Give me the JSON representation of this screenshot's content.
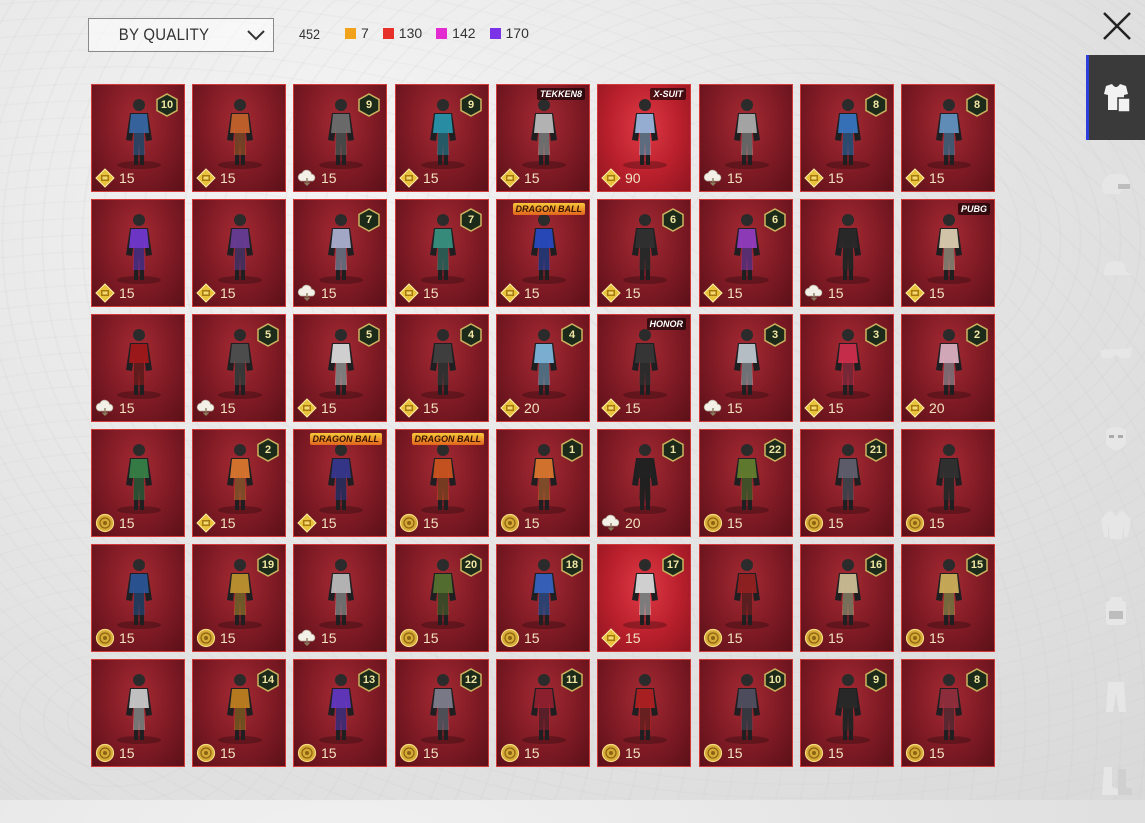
{
  "header": {
    "sort_label": "BY QUALITY",
    "total_count": "452",
    "rarity_counts": [
      {
        "color": "#f2a11b",
        "count": "7"
      },
      {
        "color": "#e8302a",
        "count": "130"
      },
      {
        "color": "#e22bd0",
        "count": "142"
      },
      {
        "color": "#7b32e6",
        "count": "170"
      }
    ]
  },
  "sidebar": {
    "tabs": [
      {
        "icon": "outfit-icon",
        "active": true
      },
      {
        "icon": "helmet-icon",
        "active": false
      },
      {
        "icon": "cap-icon",
        "active": false
      },
      {
        "icon": "goggles-icon",
        "active": false
      },
      {
        "icon": "mask-icon",
        "active": false
      },
      {
        "icon": "jacket-icon",
        "active": false
      },
      {
        "icon": "backpack-icon",
        "active": false
      },
      {
        "icon": "pants-icon",
        "active": false
      },
      {
        "icon": "boots-icon",
        "active": false
      }
    ]
  },
  "grid": {
    "cards": [
      {
        "level": "10",
        "currency": "coin",
        "cost": "15",
        "accent": "#3a6fb0"
      },
      {
        "level": "",
        "currency": "coin",
        "cost": "15",
        "accent": "#d86a2a"
      },
      {
        "level": "9",
        "currency": "cloud",
        "cost": "15",
        "accent": "#777"
      },
      {
        "level": "9",
        "currency": "coin",
        "cost": "15",
        "accent": "#2aa0b8"
      },
      {
        "level": "",
        "currency": "coin",
        "cost": "15",
        "accent": "#ccc",
        "logo": "TEKKEN8"
      },
      {
        "level": "",
        "currency": "coin",
        "cost": "90",
        "accent": "#a9c7f0",
        "logo": "X-SUIT",
        "bright": true
      },
      {
        "level": "",
        "currency": "cloud",
        "cost": "15",
        "accent": "#bbb"
      },
      {
        "level": "8",
        "currency": "coin",
        "cost": "15",
        "accent": "#3a7fd0"
      },
      {
        "level": "8",
        "currency": "coin",
        "cost": "15",
        "accent": "#6aa0d0"
      },
      {
        "level": "",
        "currency": "coin",
        "cost": "15",
        "accent": "#7a3ae0"
      },
      {
        "level": "",
        "currency": "coin",
        "cost": "15",
        "accent": "#7040a0"
      },
      {
        "level": "7",
        "currency": "cloud",
        "cost": "15",
        "accent": "#b8bfe0"
      },
      {
        "level": "7",
        "currency": "coin",
        "cost": "15",
        "accent": "#3a9e8a"
      },
      {
        "level": "",
        "currency": "coin",
        "cost": "15",
        "accent": "#2a4fd0",
        "logo": "DRAGON BALL"
      },
      {
        "level": "6",
        "currency": "coin",
        "cost": "15",
        "accent": "#333"
      },
      {
        "level": "6",
        "currency": "coin",
        "cost": "15",
        "accent": "#a040d0"
      },
      {
        "level": "",
        "currency": "cloud",
        "cost": "15",
        "accent": "#2a2a2a"
      },
      {
        "level": "",
        "currency": "coin",
        "cost": "15",
        "accent": "#f0e0c0",
        "logo": "PUBG"
      },
      {
        "level": "",
        "currency": "cloud",
        "cost": "15",
        "accent": "#b01818"
      },
      {
        "level": "5",
        "currency": "cloud",
        "cost": "15",
        "accent": "#555"
      },
      {
        "level": "5",
        "currency": "coin",
        "cost": "15",
        "accent": "#eee"
      },
      {
        "level": "4",
        "currency": "coin",
        "cost": "15",
        "accent": "#444"
      },
      {
        "level": "4",
        "currency": "coin",
        "cost": "20",
        "accent": "#8ac8f0"
      },
      {
        "level": "",
        "currency": "coin",
        "cost": "15",
        "accent": "#3a3a3a",
        "logo": "HONOR"
      },
      {
        "level": "3",
        "currency": "cloud",
        "cost": "15",
        "accent": "#cfd8e0"
      },
      {
        "level": "3",
        "currency": "coin",
        "cost": "15",
        "accent": "#e03050"
      },
      {
        "level": "2",
        "currency": "coin",
        "cost": "20",
        "accent": "#f0c0d0"
      },
      {
        "level": "",
        "currency": "round",
        "cost": "15",
        "accent": "#3a8a4a"
      },
      {
        "level": "2",
        "currency": "coin",
        "cost": "15",
        "accent": "#f08030"
      },
      {
        "level": "",
        "currency": "coin",
        "cost": "15",
        "accent": "#3a3a9a",
        "logo": "DRAGON BALL"
      },
      {
        "level": "",
        "currency": "round",
        "cost": "15",
        "accent": "#e05a20",
        "logo": "DRAGON BALL"
      },
      {
        "level": "1",
        "currency": "round",
        "cost": "15",
        "accent": "#f08030"
      },
      {
        "level": "1",
        "currency": "cloud",
        "cost": "20",
        "accent": "#222"
      },
      {
        "level": "22",
        "currency": "round",
        "cost": "15",
        "accent": "#6a8a30"
      },
      {
        "level": "21",
        "currency": "round",
        "cost": "15",
        "accent": "#667"
      },
      {
        "level": "",
        "currency": "round",
        "cost": "15",
        "accent": "#333"
      },
      {
        "level": "",
        "currency": "round",
        "cost": "15",
        "accent": "#2a5aa0"
      },
      {
        "level": "19",
        "currency": "round",
        "cost": "15",
        "accent": "#d0a030"
      },
      {
        "level": "",
        "currency": "cloud",
        "cost": "15",
        "accent": "#ccc"
      },
      {
        "level": "20",
        "currency": "round",
        "cost": "15",
        "accent": "#5a7a30"
      },
      {
        "level": "18",
        "currency": "round",
        "cost": "15",
        "accent": "#3a6ad0"
      },
      {
        "level": "17",
        "currency": "coin",
        "cost": "15",
        "accent": "#eee",
        "bright": true
      },
      {
        "level": "",
        "currency": "round",
        "cost": "15",
        "accent": "#a02020"
      },
      {
        "level": "16",
        "currency": "round",
        "cost": "15",
        "accent": "#e0d0a0"
      },
      {
        "level": "15",
        "currency": "round",
        "cost": "15",
        "accent": "#e0c060"
      },
      {
        "level": "",
        "currency": "round",
        "cost": "15",
        "accent": "#ddd"
      },
      {
        "level": "14",
        "currency": "round",
        "cost": "15",
        "accent": "#d08a20"
      },
      {
        "level": "13",
        "currency": "round",
        "cost": "15",
        "accent": "#6a3ad0"
      },
      {
        "level": "12",
        "currency": "round",
        "cost": "15",
        "accent": "#889"
      },
      {
        "level": "11",
        "currency": "round",
        "cost": "15",
        "accent": "#a02030"
      },
      {
        "level": "",
        "currency": "round",
        "cost": "15",
        "accent": "#c02020"
      },
      {
        "level": "10",
        "currency": "round",
        "cost": "15",
        "accent": "#556"
      },
      {
        "level": "9",
        "currency": "round",
        "cost": "15",
        "accent": "#2a2a2a"
      },
      {
        "level": "8",
        "currency": "round",
        "cost": "15",
        "accent": "#a03040"
      }
    ]
  }
}
